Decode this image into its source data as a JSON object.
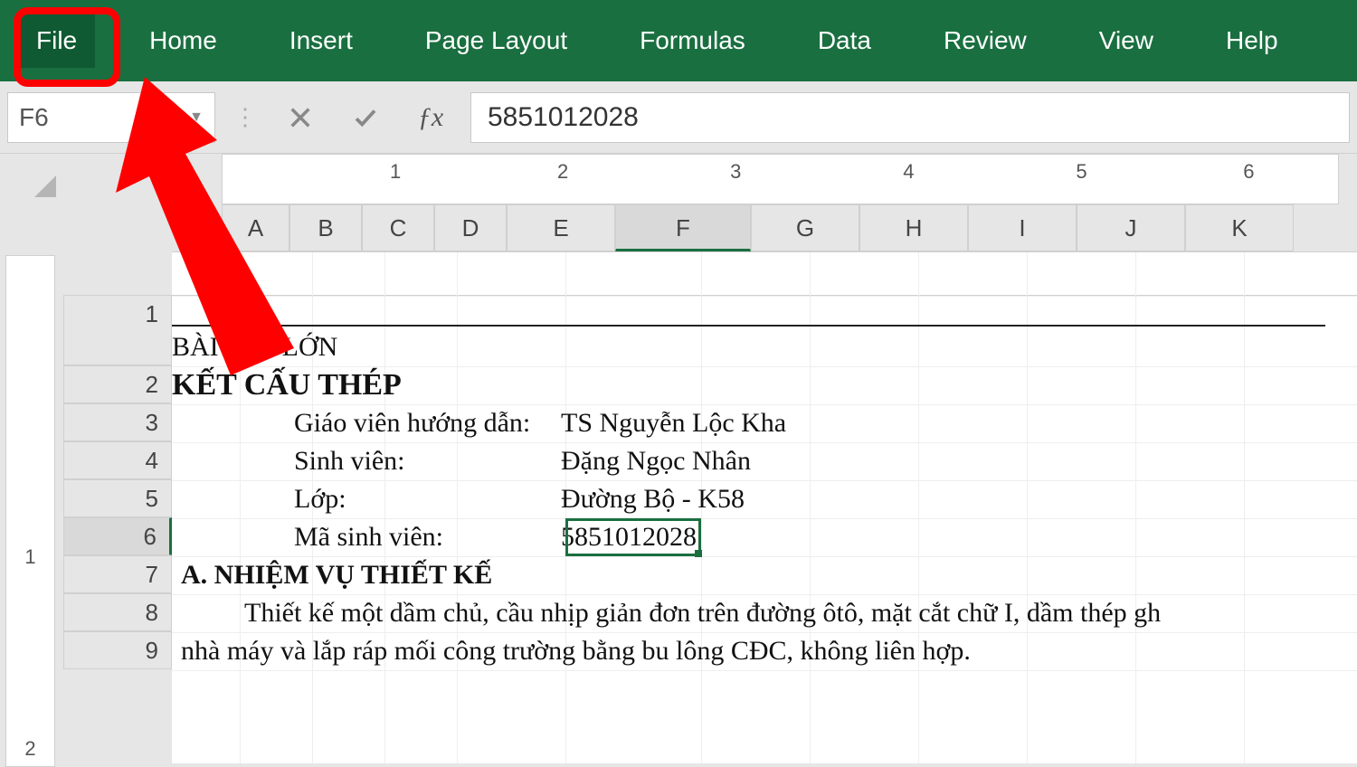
{
  "ribbon": {
    "tabs": [
      "File",
      "Home",
      "Insert",
      "Page Layout",
      "Formulas",
      "Data",
      "Review",
      "View",
      "Help"
    ]
  },
  "namebox": {
    "value": "F6"
  },
  "formula": {
    "value": "5851012028"
  },
  "ruler": {
    "ticks": [
      "1",
      "2",
      "3",
      "4",
      "5",
      "6"
    ]
  },
  "columns": [
    "A",
    "B",
    "C",
    "D",
    "E",
    "F",
    "G",
    "H",
    "I",
    "J",
    "K"
  ],
  "selectedCol": "F",
  "rows": [
    "1",
    "2",
    "3",
    "4",
    "5",
    "6",
    "7",
    "8",
    "9"
  ],
  "selectedRow": "6",
  "pageRulerTicks": [
    "1",
    "2"
  ],
  "doc": {
    "supertitle": "BÀI TẬP LỚN",
    "title": "KẾT CẤU THÉP",
    "fields": [
      {
        "label": "Giáo viên hướng dẫn:",
        "value": "TS Nguyễn Lộc Kha"
      },
      {
        "label": "Sinh viên:",
        "value": "Đặng Ngọc Nhân"
      },
      {
        "label": "Lớp:",
        "value": "Đường Bộ - K58"
      },
      {
        "label": "Mã sinh viên:",
        "value": "5851012028"
      }
    ],
    "sectionA": "A. NHIỆM VỤ THIẾT KẾ",
    "para1": "Thiết kế một dầm chủ, cầu nhịp giản đơn trên đường ôtô, mặt cắt chữ I, dầm thép gh",
    "para2": "nhà máy và lắp ráp mối công trường bằng bu lông CĐC, không liên hợp."
  }
}
